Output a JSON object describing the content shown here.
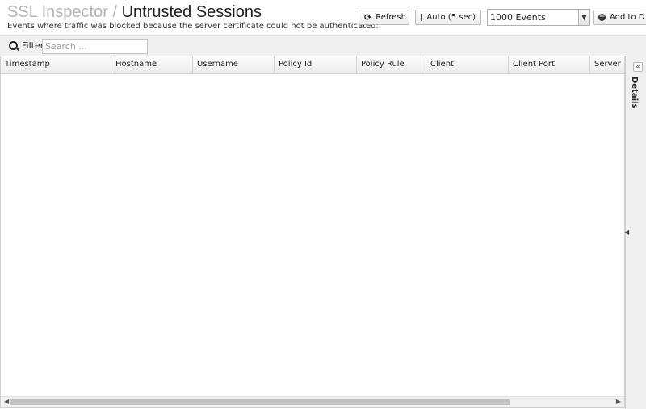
{
  "header": {
    "app_name": "SSL Inspector",
    "separator": "/",
    "page_title": "Untrusted Sessions",
    "subtitle": "Events where traffic was blocked because the server certificate could not be authenticated."
  },
  "toolbar": {
    "refresh_label": "Refresh",
    "auto_label": "Auto (5 sec)",
    "events_select_value": "1000 Events",
    "add_label": "Add to D"
  },
  "filter": {
    "label": "Filter",
    "placeholder": "Search ..."
  },
  "grid": {
    "columns": [
      "Timestamp",
      "Hostname",
      "Username",
      "Policy Id",
      "Policy Rule",
      "Client",
      "Client Port",
      "Server"
    ],
    "rows": []
  },
  "details": {
    "label": "Details"
  },
  "icons": {
    "refresh": "refresh-icon",
    "checkbox": "checkbox-icon",
    "add": "plus-circle-icon",
    "search": "search-icon",
    "collapse": "double-chevron-left-icon"
  }
}
